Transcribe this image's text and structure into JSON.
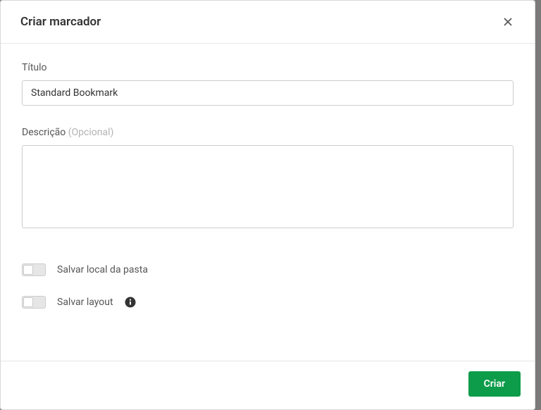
{
  "modal": {
    "title": "Criar marcador",
    "fields": {
      "title": {
        "label": "Título",
        "value": "Standard Bookmark"
      },
      "description": {
        "label": "Descrição",
        "optional_suffix": " (Opcional)",
        "value": ""
      }
    },
    "toggles": {
      "save_folder": {
        "label": "Salvar local da pasta",
        "checked": false
      },
      "save_layout": {
        "label": "Salvar layout",
        "checked": false
      }
    },
    "actions": {
      "create": "Criar"
    }
  }
}
